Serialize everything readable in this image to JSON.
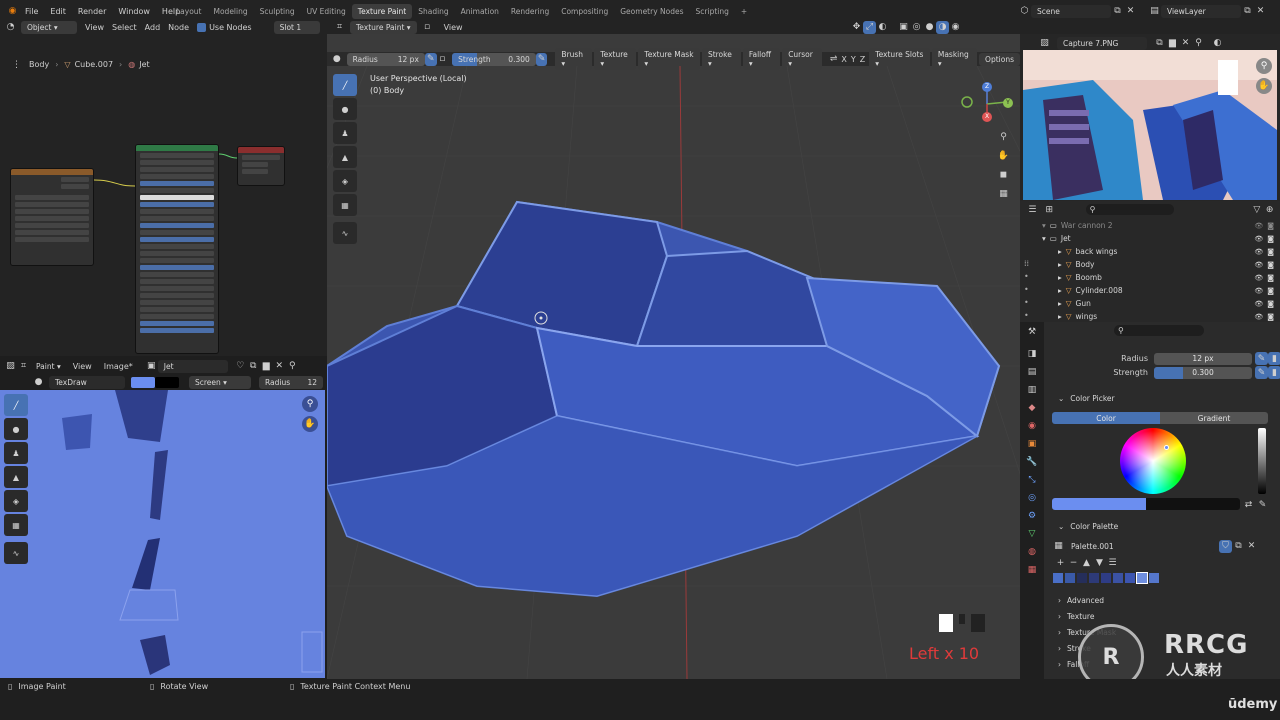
{
  "top_menu": {
    "items": [
      "File",
      "Edit",
      "Render",
      "Window",
      "Help"
    ],
    "workspaces": [
      "Layout",
      "Modeling",
      "Sculpting",
      "UV Editing",
      "Texture Paint",
      "Shading",
      "Animation",
      "Rendering",
      "Compositing",
      "Geometry Nodes",
      "Scripting"
    ],
    "active_workspace": "Texture Paint",
    "add_tab": "+",
    "scene": "Scene",
    "view_layer": "ViewLayer"
  },
  "node_editor": {
    "mode": "Object",
    "menu": [
      "View",
      "Select",
      "Add",
      "Node"
    ],
    "use_nodes_label": "Use Nodes",
    "slot": "Slot 1",
    "breadcrumb": [
      "Body",
      "Cube.007",
      "Jet"
    ]
  },
  "viewport_header": {
    "mode": "Texture Paint",
    "view": "View",
    "radius_label": "Radius",
    "radius_value": "12 px",
    "strength_label": "Strength",
    "strength_value": "0.300",
    "menus": [
      "Brush",
      "Texture",
      "Texture Mask",
      "Stroke",
      "Falloff",
      "Cursor"
    ],
    "axes": [
      "X",
      "Y",
      "Z"
    ],
    "texture_slots": "Texture Slots",
    "masking": "Masking",
    "options": "Options"
  },
  "viewport": {
    "perspective": "User Perspective (Local)",
    "object": "(0) Body",
    "overlay_text": "Left x 10",
    "gizmo": {
      "z": "Z",
      "y": "Y",
      "x": "X"
    }
  },
  "image_editor": {
    "mode": "Paint",
    "view": "View",
    "image_menu": "Image*",
    "image_name": "Jet",
    "brush_name": "TexDraw",
    "blend": "Screen",
    "radius_label": "Radius",
    "radius_value": "12"
  },
  "image_viewer": {
    "image_name": "Capture 7.PNG"
  },
  "outliner": {
    "rows": [
      {
        "name": "War cannon 2",
        "depth": 0,
        "icon": "collection-icon",
        "dim": true
      },
      {
        "name": "Jet",
        "depth": 0,
        "icon": "collection-icon",
        "dim": false
      },
      {
        "name": "back wings",
        "depth": 1,
        "icon": "mesh-icon",
        "dim": false
      },
      {
        "name": "Body",
        "depth": 1,
        "icon": "mesh-icon",
        "dim": false
      },
      {
        "name": "Boomb",
        "depth": 1,
        "icon": "mesh-icon",
        "dim": false
      },
      {
        "name": "Cylinder.008",
        "depth": 1,
        "icon": "mesh-icon",
        "dim": false
      },
      {
        "name": "Gun",
        "depth": 1,
        "icon": "mesh-icon",
        "dim": false
      },
      {
        "name": "wings",
        "depth": 1,
        "icon": "mesh-icon",
        "dim": false
      }
    ]
  },
  "properties": {
    "radius_label": "Radius",
    "radius_value": "12 px",
    "strength_label": "Strength",
    "strength_value": "0.300",
    "strength_fraction": 0.3,
    "color_picker_title": "Color Picker",
    "color_tab": "Color",
    "gradient_tab": "Gradient",
    "color_palette_title": "Color Palette",
    "palette_name": "Palette.001",
    "palette_colors": [
      "#4a6fc7",
      "#3a5aa8",
      "#252e5a",
      "#2d3a78",
      "#2e3c85",
      "#3b52a3",
      "#3c55b0",
      "#6f8fe0",
      "#5577cc"
    ],
    "collapsed_panels": [
      "Advanced",
      "Texture",
      "Texture Mask",
      "Stroke",
      "Falloff"
    ],
    "brush_color": "#6b8ef0"
  },
  "status_bar": {
    "items": [
      "Image Paint",
      "Rotate View",
      "Texture Paint Context Menu"
    ]
  },
  "watermark": {
    "brand": "RRCG",
    "sub": "人人素材",
    "udemy": "ūdemy"
  },
  "colors": {
    "accent": "#4772b3",
    "paint_blue": "#6683df",
    "mesh_blue": "#3c56b0",
    "overlay_red": "#e03a3a"
  }
}
